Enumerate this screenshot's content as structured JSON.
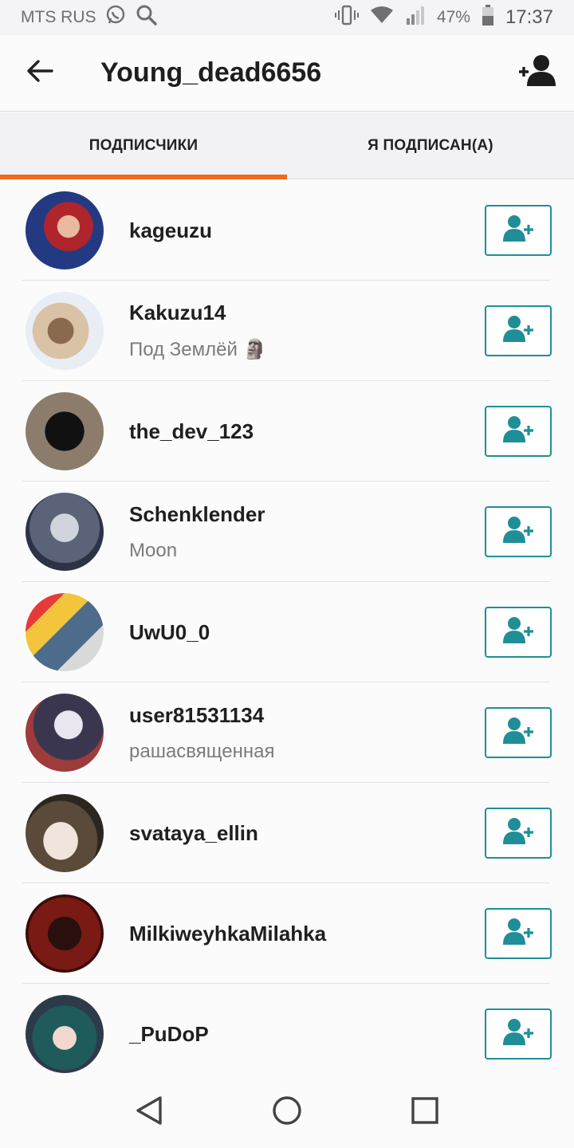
{
  "status": {
    "carrier": "MTS RUS",
    "battery": "47%",
    "time": "17:37"
  },
  "header": {
    "title": "Young_dead6656",
    "back_icon": "back-arrow-icon",
    "add_icon": "add-person-icon"
  },
  "tabs": [
    {
      "label": "ПОДПИСЧИКИ",
      "active": true
    },
    {
      "label": "Я ПОДПИСАН(А)",
      "active": false
    }
  ],
  "users": [
    {
      "name": "kageuzu",
      "subtitle": ""
    },
    {
      "name": "Kakuzu14",
      "subtitle": "Под Землёй 🗿"
    },
    {
      "name": "the_dev_123",
      "subtitle": ""
    },
    {
      "name": "Schenklender",
      "subtitle": "Moon"
    },
    {
      "name": "UwU0_0",
      "subtitle": ""
    },
    {
      "name": "user81531134",
      "subtitle": "рашасвященная"
    },
    {
      "name": "svataya_ellin",
      "subtitle": ""
    },
    {
      "name": "MilkiweyhkaMilahka",
      "subtitle": ""
    },
    {
      "name": "_PuDoP",
      "subtitle": ""
    }
  ],
  "colors": {
    "accent": "#f26a1b",
    "follow": "#1f8e97"
  }
}
